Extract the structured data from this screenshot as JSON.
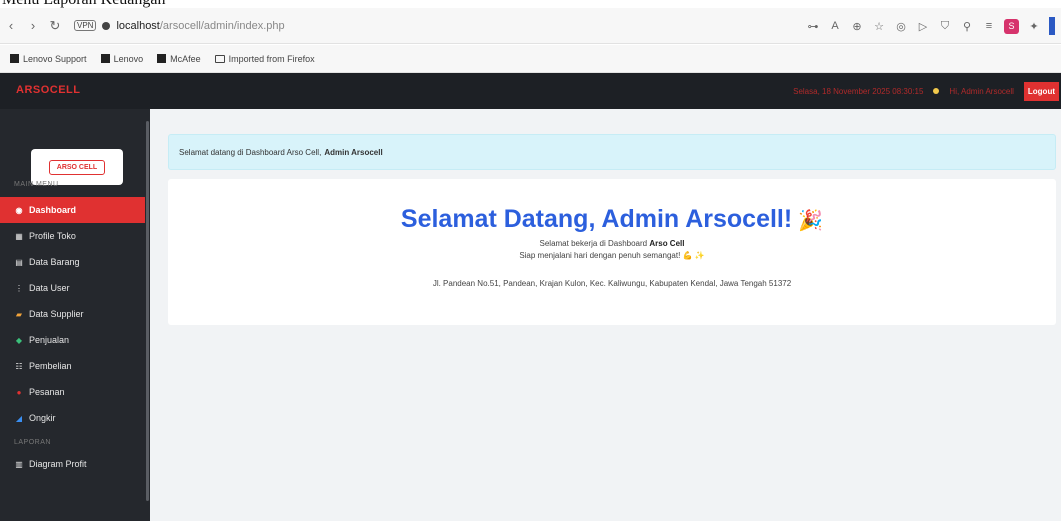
{
  "caption": "Menu Laporan Keuangan",
  "browser": {
    "url_host": "localhost",
    "url_path": "/arsocell/admin/index.php",
    "vpn_label": "VPN"
  },
  "bookmarks": [
    {
      "label": "Lenovo Support",
      "icon": "bookmark-icon"
    },
    {
      "label": "Lenovo",
      "icon": "bookmark-icon"
    },
    {
      "label": "McAfee",
      "icon": "bookmark-icon"
    },
    {
      "label": "Imported from Firefox",
      "icon": "folder-icon"
    }
  ],
  "topbar": {
    "brand": "ARSOCELL",
    "date_text": "Selasa, 18 November 2025 08:30:15",
    "user_text": "Hi, Admin Arsocell",
    "logout_label": "Logout"
  },
  "sidebar": {
    "logo_text": "ARSO CELL",
    "section_main": "MAIN MENU",
    "section_reports": "LAPORAN",
    "items": [
      {
        "label": "Dashboard",
        "icon": "dashboard-icon",
        "active": true
      },
      {
        "label": "Profile Toko",
        "icon": "store-icon"
      },
      {
        "label": "Data Barang",
        "icon": "box-icon"
      },
      {
        "label": "Data User",
        "icon": "user-icon"
      },
      {
        "label": "Data Supplier",
        "icon": "truck-icon"
      },
      {
        "label": "Penjualan",
        "icon": "cart-icon"
      },
      {
        "label": "Pembelian",
        "icon": "bag-icon"
      },
      {
        "label": "Pesanan",
        "icon": "order-icon"
      },
      {
        "label": "Ongkir",
        "icon": "shipping-icon"
      }
    ],
    "report_items": [
      {
        "label": "Diagram Profit",
        "icon": "chart-icon"
      }
    ]
  },
  "main": {
    "alert_text": "Selamat datang di Dashboard Arso Cell,",
    "alert_name": "Admin Arsocell",
    "welcome_title": "Selamat Datang, Admin Arsocell!",
    "welcome_emoji": "🎉",
    "sub1_text": "Selamat bekerja di Dashboard",
    "sub1_bold": "Arso Cell",
    "sub2_text": "Siap menjalani hari dengan penuh semangat! 💪 ✨",
    "address": "Jl. Pandean No.51, Pandean, Krajan Kulon, Kec. Kaliwungu, Kabupaten Kendal, Jawa Tengah 51372"
  },
  "colors": {
    "accent": "#e03131",
    "sidebar_bg": "#25282d",
    "welcome_blue": "#2c5fdd",
    "alert_bg": "#d8f3fa"
  }
}
